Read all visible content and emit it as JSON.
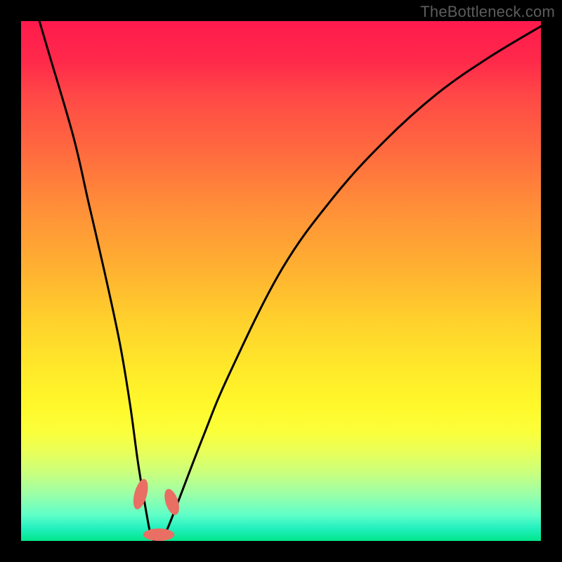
{
  "watermark": "TheBottleneck.com",
  "chart_data": {
    "type": "line",
    "title": "",
    "xlabel": "",
    "ylabel": "",
    "xlim": [
      0,
      100
    ],
    "ylim": [
      0,
      100
    ],
    "series": [
      {
        "name": "bottleneck-curve",
        "x": [
          0,
          5,
          10,
          13,
          16,
          19,
          21,
          22.5,
          24,
          25,
          26,
          27,
          28,
          30,
          35,
          40,
          50,
          60,
          70,
          80,
          90,
          100
        ],
        "values": [
          112,
          95,
          78,
          65,
          52,
          38,
          26,
          15,
          6,
          1,
          0,
          0.5,
          2,
          7,
          20,
          32,
          52,
          66,
          77,
          86,
          93,
          99
        ]
      }
    ],
    "markers": [
      {
        "name": "left-knee-segment",
        "cx": 23.0,
        "cy": 9.0,
        "rx": 1.2,
        "ry": 3.0,
        "rot": 15
      },
      {
        "name": "right-knee-segment",
        "cx": 29.0,
        "cy": 7.5,
        "rx": 1.2,
        "ry": 2.6,
        "rot": -18
      },
      {
        "name": "bottom-segment",
        "cx": 26.5,
        "cy": 1.2,
        "rx": 3.0,
        "ry": 1.2,
        "rot": 0
      }
    ],
    "colors": {
      "curve": "#000000",
      "marker": "#e96e63"
    }
  }
}
